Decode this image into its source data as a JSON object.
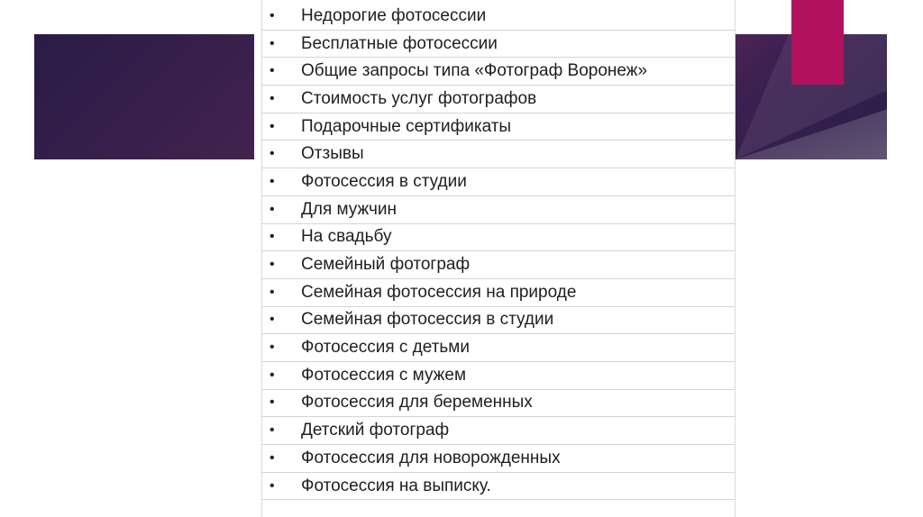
{
  "colors": {
    "band_dark": "#2a1b47",
    "band_mid": "#6b2c5b",
    "accent": "#b0125e",
    "grid": "#d4d4d4"
  },
  "list": {
    "bullet": "•",
    "items": [
      "Недорогие фотосессии",
      "Бесплатные фотосессии",
      "Общие запросы типа «Фотограф Воронеж»",
      "Стоимость услуг фотографов",
      "Подарочные сертификаты",
      "Отзывы",
      "Фотосессия в студии",
      "Для мужчин",
      "На свадьбу",
      "Семейный фотограф",
      "Семейная фотосессия на природе",
      "Семейная фотосессия в студии",
      "Фотосессия с детьми",
      "Фотосессия с мужем",
      "Фотосессия для беременных",
      "Детский фотограф",
      "Фотосессия для новорожденных",
      "Фотосессия на выписку."
    ]
  }
}
